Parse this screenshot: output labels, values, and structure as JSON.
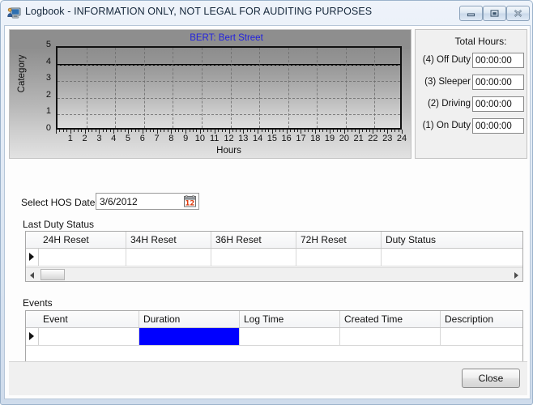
{
  "window": {
    "title": "Logbook - INFORMATION ONLY,  NOT LEGAL FOR AUDITING PURPOSES",
    "icon": "computer-monitor-user-icon",
    "minimize_label": "Minimize",
    "maximize_label": "Maximize",
    "close_label": "Close"
  },
  "chart_data": {
    "type": "line",
    "title": "BERT: Bert  Street",
    "xlabel": "Hours",
    "ylabel": "Category",
    "xlim": [
      0,
      24
    ],
    "ylim": [
      0,
      5
    ],
    "xticks": [
      1,
      2,
      3,
      4,
      5,
      6,
      7,
      8,
      9,
      10,
      11,
      12,
      13,
      14,
      15,
      16,
      17,
      18,
      19,
      20,
      21,
      22,
      23,
      24
    ],
    "yticks": [
      0,
      1,
      2,
      3,
      4,
      5
    ],
    "grid": true,
    "legend": "none",
    "title_color": "#2222dd",
    "series": [
      {
        "name": "Duty Status",
        "x": [
          0,
          24
        ],
        "values": [
          4,
          4
        ]
      }
    ]
  },
  "totals": {
    "heading": "Total Hours:",
    "rows": [
      {
        "label": "(4) Off Duty",
        "value": "00:00:00"
      },
      {
        "label": "(3)   Sleeper",
        "value": "00:00:00"
      },
      {
        "label": "(2)   Driving",
        "value": "00:00:00"
      },
      {
        "label": "(1)  On Duty",
        "value": "00:00:00"
      }
    ]
  },
  "date_row": {
    "label": "Select HOS Date",
    "value": "3/6/2012",
    "placeholder": "",
    "icon": "calendar-icon"
  },
  "last_duty_status": {
    "group_label": "Last Duty Status",
    "columns": [
      "24H Reset",
      "34H Reset",
      "36H Reset",
      "72H Reset",
      "Duty Status"
    ],
    "rows": [
      {
        "cells": [
          "",
          "",
          "",
          "",
          ""
        ],
        "selected_column": null
      }
    ],
    "scrollbar": {
      "left_arrow": "left-arrow",
      "right_arrow": "right-arrow"
    }
  },
  "events": {
    "group_label": "Events",
    "columns": [
      "Event",
      "Duration",
      "Log Time",
      "Created Time",
      "Description"
    ],
    "rows": [
      {
        "cells": [
          "",
          "",
          "",
          "",
          ""
        ],
        "selected_column": "Duration"
      }
    ],
    "selection_color": "#0000ff",
    "scrollbar": {
      "left_arrow": "left-arrow",
      "right_arrow": "right-arrow"
    }
  },
  "footer": {
    "close_button": "Close"
  }
}
